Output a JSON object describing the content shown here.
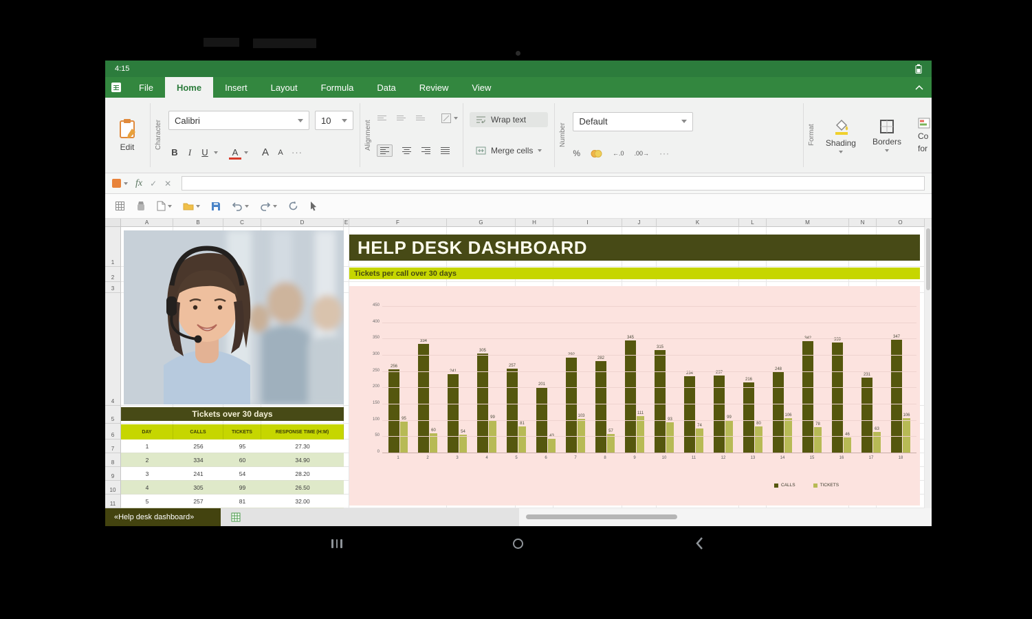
{
  "colors": {
    "chrome_green": "#2c7c3c",
    "olive_dark": "#474a16",
    "yellow_green": "#c6d600",
    "chart_bg": "#fce3df",
    "calls_color": "#55570e",
    "tickets_color": "#b7ba55",
    "row_alt": "#dfe9c9"
  },
  "status_bar": {
    "time": "4:15"
  },
  "tab_bar": {
    "tabs": [
      "File",
      "Home",
      "Insert",
      "Layout",
      "Formula",
      "Data",
      "Review",
      "View"
    ],
    "active_tab": "Home"
  },
  "ribbon": {
    "edit": {
      "label": "Edit"
    },
    "character": {
      "group_label": "Character",
      "font_name": "Calibri",
      "font_size": "10",
      "bold": "B",
      "italic": "I",
      "underline": "U",
      "font_color": "A",
      "grow": "A",
      "shrink": "A",
      "more": "···"
    },
    "alignment": {
      "group_label": "Alignment"
    },
    "wrap_text": "Wrap text",
    "merge_cells": "Merge cells",
    "number": {
      "group_label": "Number",
      "format": "Default",
      "percent": "%",
      "inc_decimal": "←.0",
      "dec_decimal": ".00→",
      "more": "···"
    },
    "format": {
      "group_label": "Format",
      "shading": "Shading",
      "borders": "Borders",
      "conditional_line1": "Co",
      "conditional_line2": "for"
    }
  },
  "formula_bar": {
    "fx": "fx",
    "confirm": "✓",
    "cancel": "✕"
  },
  "sheet": {
    "col_headers": [
      "A",
      "B",
      "C",
      "D",
      "E",
      "F",
      "G",
      "H",
      "I",
      "J",
      "K",
      "L",
      "M",
      "N",
      "O"
    ],
    "row_headers": [
      "1",
      "2",
      "3",
      "4",
      "5",
      "6",
      "7",
      "8",
      "9",
      "10",
      "11"
    ],
    "dashboard_title": "HELP DESK DASHBOARD",
    "dashboard_subtitle": "Tickets per call over 30 days",
    "table": {
      "title": "Tickets over 30 days",
      "headers": [
        "DAY",
        "CALLS",
        "TICKETS",
        "RESPONSE TIME (H:M)"
      ],
      "rows": [
        [
          "1",
          "256",
          "95",
          "27.30"
        ],
        [
          "2",
          "334",
          "60",
          "34.90"
        ],
        [
          "3",
          "241",
          "54",
          "28.20"
        ],
        [
          "4",
          "305",
          "99",
          "26.50"
        ],
        [
          "5",
          "257",
          "81",
          "32.00"
        ]
      ]
    }
  },
  "chart_data": {
    "type": "bar",
    "title": "Tickets per call over 30 days",
    "categories": [
      "1",
      "2",
      "3",
      "4",
      "5",
      "6",
      "7",
      "8",
      "9",
      "10",
      "11",
      "12",
      "13",
      "14",
      "15",
      "16",
      "17",
      "18"
    ],
    "series": [
      {
        "name": "CALLS",
        "color": "#55570e",
        "values": [
          256,
          334,
          241,
          305,
          257,
          201,
          292,
          282,
          345,
          315,
          234,
          237,
          216,
          248,
          342,
          339,
          231,
          347
        ]
      },
      {
        "name": "TICKETS",
        "color": "#b7ba55",
        "values": [
          95,
          60,
          54,
          99,
          81,
          43,
          103,
          57,
          111,
          93,
          74,
          99,
          80,
          106,
          78,
          46,
          63,
          106
        ]
      }
    ],
    "ylim": [
      0,
      450
    ],
    "ytick_step": 50,
    "grid": true,
    "legend_position": "bottom-right",
    "plot_bg": "#fce3df",
    "value_labels": true
  },
  "sheet_tabs": {
    "active": "«Help desk dashboard»"
  }
}
